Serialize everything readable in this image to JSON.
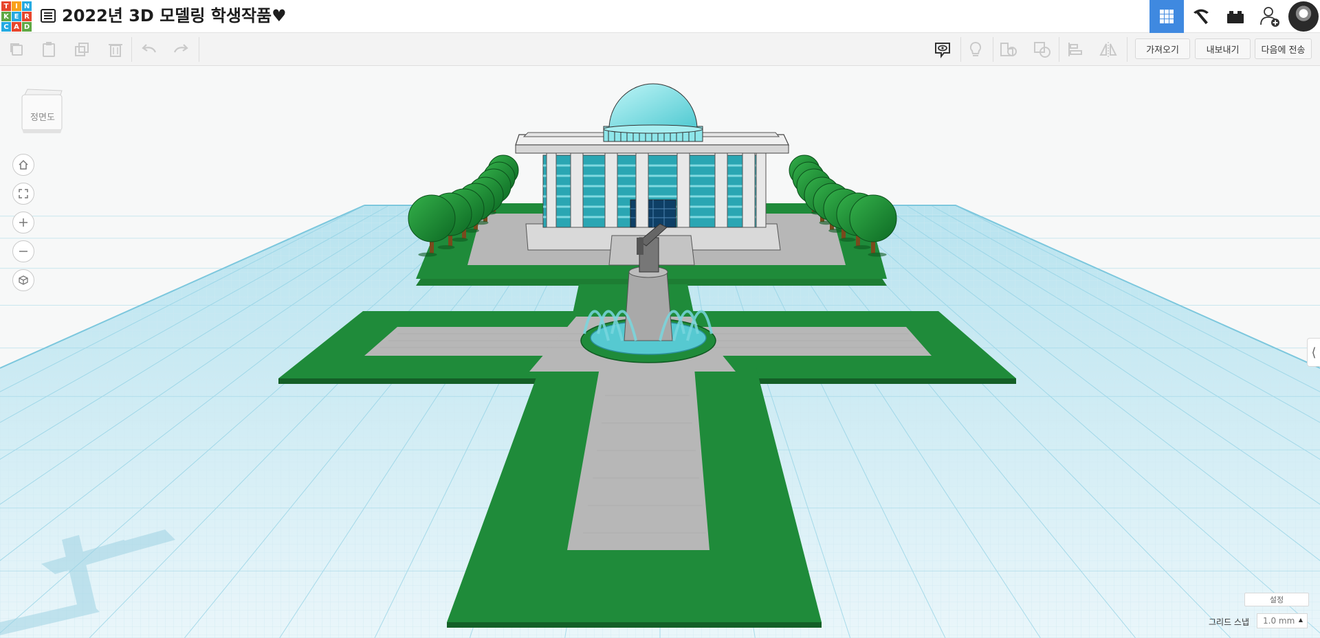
{
  "app": {
    "logo_letters": [
      "T",
      "I",
      "N",
      "K",
      "E",
      "R",
      "C",
      "A",
      "D"
    ],
    "logo_colors": [
      "#e7462d",
      "#f9a11b",
      "#25aae1",
      "#60a844",
      "#25aae1",
      "#e7462d",
      "#25aae1",
      "#e7462d",
      "#60a844"
    ],
    "design_title": "2022년 3D 모델링 학생작품♥"
  },
  "header": {
    "right_buttons": [
      {
        "name": "3d-design-view",
        "icon": "grid-icon",
        "active": true
      },
      {
        "name": "blocks-view",
        "icon": "pickaxe-icon",
        "active": false
      },
      {
        "name": "bricks-view",
        "icon": "brick-icon",
        "active": false
      },
      {
        "name": "invite-user",
        "icon": "add-user-icon",
        "active": false
      },
      {
        "name": "profile",
        "icon": "avatar",
        "active": false
      }
    ]
  },
  "toolbar": {
    "left_icons": [
      "copy-icon",
      "paste-icon",
      "duplicate-icon",
      "delete-icon",
      "undo-icon",
      "redo-icon"
    ],
    "right_icons": [
      "notes-icon",
      "light-icon",
      "shape-icon",
      "group-icon",
      "align-icon",
      "mirror-icon"
    ],
    "import_label": "가져오기",
    "export_label": "내보내기",
    "send_to_label": "다음에 전송"
  },
  "viewcube": {
    "face_label": "정면도"
  },
  "nav_controls": [
    "home-icon",
    "fit-icon",
    "zoom-in-icon",
    "zoom-out-icon",
    "perspective-icon"
  ],
  "bottom": {
    "settings_label": "설정",
    "grid_snap_label": "그리드 스냅",
    "grid_snap_value": "1.0 mm"
  },
  "colors": {
    "accent": "#3f89e0",
    "grass": "#1f8b3a",
    "path": "#b7b7b7",
    "water": "#56c9d1",
    "building_glass": "#2aa6b3",
    "dome": "#8ee6ea",
    "grid": "#bfe3ee"
  }
}
